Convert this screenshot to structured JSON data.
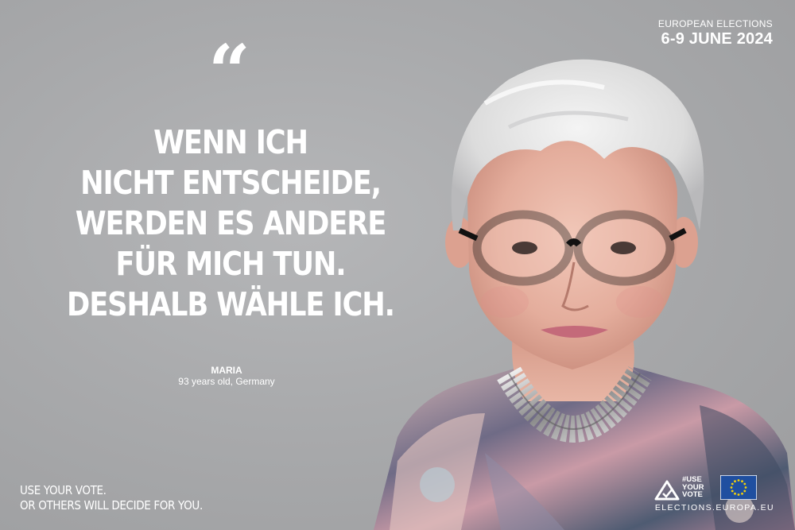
{
  "header": {
    "line1": "EUROPEAN ELECTIONS",
    "line2": "6-9 JUNE 2024"
  },
  "quote": {
    "mark": "“",
    "lines": [
      "WENN ICH",
      "NICHT ENTSCHEIDE,",
      "WERDEN ES ANDERE",
      "FÜR MICH TUN.",
      "DESHALB WÄHLE ICH."
    ]
  },
  "attribution": {
    "name": "MARIA",
    "description": "93 years old, Germany"
  },
  "slogan": {
    "line1": "USE YOUR VOTE.",
    "line2": "OR OTHERS WILL DECIDE FOR YOU."
  },
  "footer": {
    "campaign_lines": [
      "#USE",
      "YOUR",
      "VOTE"
    ],
    "website": "ELECTIONS.EUROPA.EU",
    "icons": [
      "use-your-vote-triangle-icon",
      "eu-flag-icon"
    ]
  },
  "colors": {
    "background": "#a8a9ab",
    "text": "#ffffff",
    "eu_blue": "#1f4fa0",
    "eu_star": "#f5d20a"
  }
}
